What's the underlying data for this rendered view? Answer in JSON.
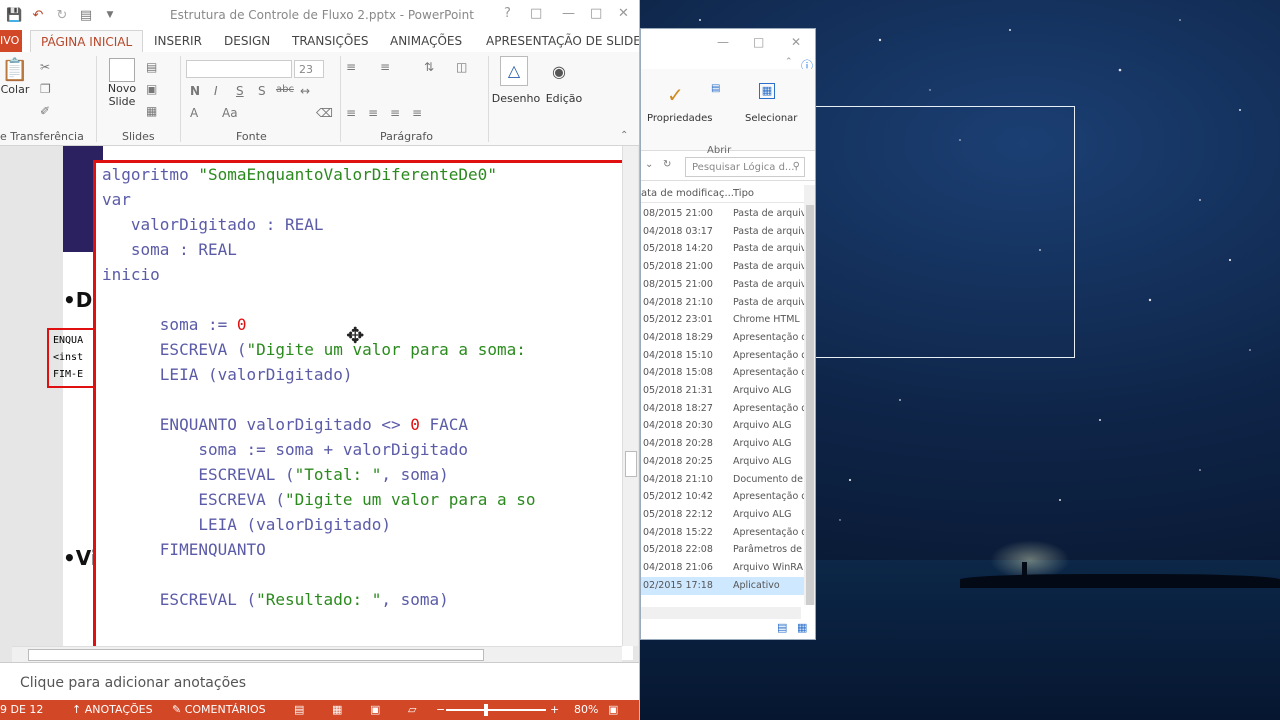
{
  "ppt": {
    "window_title": "Estrutura de Controle de Fluxo 2.pptx - PowerPoint",
    "tabs": [
      "PÁGINA INICIAL",
      "INSERIR",
      "DESIGN",
      "TRANSIÇÕES",
      "ANIMAÇÕES",
      "APRESENTAÇÃO DE SLIDES"
    ],
    "file_tab": "IVO",
    "ribbon": {
      "colar": "Colar",
      "novo": "Novo",
      "slide": "Slide",
      "desenho": "Desenho",
      "edicao": "Edição",
      "font_size": "23",
      "groups": [
        "e Transferência",
        "Slides",
        "Fonte",
        "Parágrafo"
      ]
    },
    "slide": {
      "bullet1": "•De",
      "bullet2": "•Vi",
      "mini_lines": [
        "ENQUA",
        "<inst",
        "FIM-E"
      ],
      "code_lines": [
        {
          "text": "algoritmo ",
          "str": "\"SomaEnquantoValorDiferenteDe0\""
        },
        {
          "text": "var"
        },
        {
          "text": "   valorDigitado : REAL"
        },
        {
          "text": "   soma : REAL"
        },
        {
          "text": "inicio"
        },
        {
          "text": ""
        },
        {
          "text": "      soma := ",
          "num": "0"
        },
        {
          "text": "      ESCREVA (",
          "str": "\"Digite um valor para a soma: "
        },
        {
          "text": "      LEIA (valorDigitado)"
        },
        {
          "text": ""
        },
        {
          "text": "      ENQUANTO valorDigitado <> ",
          "num": "0",
          "tail": " FACA"
        },
        {
          "text": "          soma := soma + valorDigitado"
        },
        {
          "text": "          ESCREVAL (",
          "str": "\"Total: \"",
          "tail": ", soma)"
        },
        {
          "text": "          ESCREVA (",
          "str": "\"Digite um valor para a so"
        },
        {
          "text": "          LEIA (valorDigitado)"
        },
        {
          "text": "      FIMENQUANTO"
        },
        {
          "text": ""
        },
        {
          "text": "      ESCREVAL (",
          "str": "\"Resultado: \"",
          "tail": ", soma)"
        }
      ]
    },
    "notes_placeholder": "Clique para adicionar anotações",
    "status": {
      "slide": "9 DE 12",
      "notes": "ANOTAÇÕES",
      "comments": "COMENTÁRIOS",
      "zoom": "80%"
    }
  },
  "explorer": {
    "ribbon": {
      "propriedades": "Propriedades",
      "abrir": "Abrir",
      "selecionar": "Selecionar"
    },
    "search_placeholder": "Pesquisar Lógica d...",
    "columns": [
      "ata de modificaç...",
      "Tipo"
    ],
    "rows": [
      {
        "date": "08/2015 21:00",
        "type": "Pasta de arquiv"
      },
      {
        "date": "04/2018 03:17",
        "type": "Pasta de arquiv"
      },
      {
        "date": "05/2018 14:20",
        "type": "Pasta de arquiv"
      },
      {
        "date": "05/2018 21:00",
        "type": "Pasta de arquiv"
      },
      {
        "date": "08/2015 21:00",
        "type": "Pasta de arquiv"
      },
      {
        "date": "04/2018 21:10",
        "type": "Pasta de arquiv"
      },
      {
        "date": "05/2012 23:01",
        "type": "Chrome HTML"
      },
      {
        "date": "04/2018 18:29",
        "type": "Apresentação d"
      },
      {
        "date": "04/2018 15:10",
        "type": "Apresentação d"
      },
      {
        "date": "04/2018 15:08",
        "type": "Apresentação d"
      },
      {
        "date": "05/2018 21:31",
        "type": "Arquivo ALG"
      },
      {
        "date": "04/2018 18:27",
        "type": "Apresentação d"
      },
      {
        "date": "04/2018 20:30",
        "type": "Arquivo ALG"
      },
      {
        "date": "04/2018 20:28",
        "type": "Arquivo ALG"
      },
      {
        "date": "04/2018 20:25",
        "type": "Arquivo ALG"
      },
      {
        "date": "04/2018 21:10",
        "type": "Documento de"
      },
      {
        "date": "05/2012 10:42",
        "type": "Apresentação d"
      },
      {
        "date": "05/2018 22:12",
        "type": "Arquivo ALG"
      },
      {
        "date": "04/2018 15:22",
        "type": "Apresentação d"
      },
      {
        "date": "05/2018 22:08",
        "type": "Parâmetros de"
      },
      {
        "date": "04/2018 21:06",
        "type": "Arquivo WinRA"
      },
      {
        "date": "02/2015 17:18",
        "type": "Aplicativo"
      }
    ]
  }
}
